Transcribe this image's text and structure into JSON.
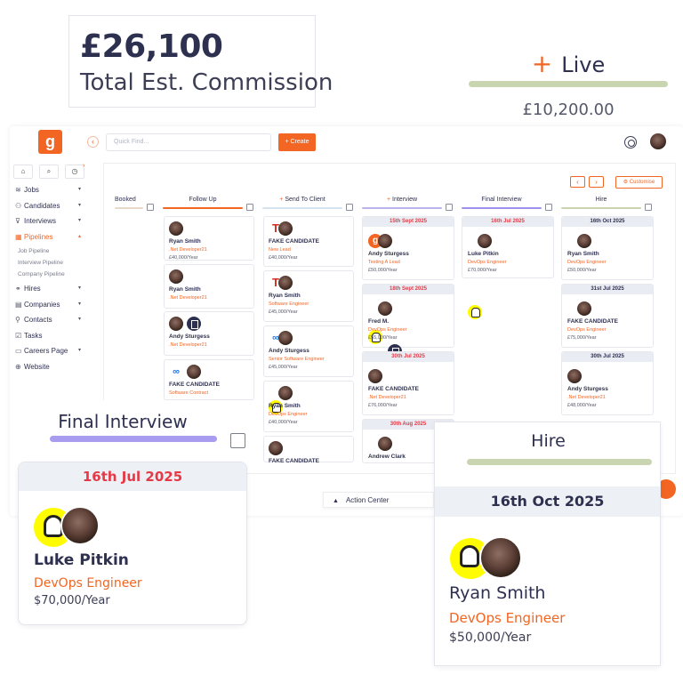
{
  "commission": {
    "value": "£26,100",
    "label": "Total Est. Commission"
  },
  "live": {
    "plus": "+",
    "label": "Live",
    "amount": "£10,200.00",
    "bar_color": "#c9d5b0"
  },
  "header": {
    "logo": "g",
    "collapse": "‹",
    "search_placeholder": "Quick Find...",
    "create_label": "+ Create"
  },
  "sidebar": {
    "quick_icons": [
      "home-icon",
      "search-icon",
      "clock-icon"
    ],
    "items": [
      {
        "label": "Jobs",
        "icon": "layers-icon",
        "chevron": "▾"
      },
      {
        "label": "Candidates",
        "icon": "users-icon",
        "chevron": "▾"
      },
      {
        "label": "Interviews",
        "icon": "filter-icon",
        "chevron": "▾"
      },
      {
        "label": "Pipelines",
        "icon": "grid-icon",
        "chevron": "▴",
        "active": true
      },
      {
        "label": "Hires",
        "icon": "handshake-icon",
        "chevron": "▾"
      },
      {
        "label": "Companies",
        "icon": "building-icon",
        "chevron": "▾"
      },
      {
        "label": "Contacts",
        "icon": "person-icon",
        "chevron": "▾"
      },
      {
        "label": "Tasks",
        "icon": "checkbox-icon",
        "chevron": ""
      },
      {
        "label": "Careers Page",
        "icon": "briefcase-icon",
        "chevron": "▾"
      },
      {
        "label": "Website",
        "icon": "globe-icon",
        "chevron": ""
      }
    ],
    "subitems": [
      "Job Pipeline",
      "Interview Pipeline",
      "Company Pipeline"
    ]
  },
  "board": {
    "prev": "‹",
    "next": "›",
    "customise_label": "⚙ Customise",
    "columns": [
      {
        "title": "Booked",
        "plus": "",
        "color": "#e8d9c8"
      },
      {
        "title": "Follow Up",
        "plus": "",
        "color": "#f26522"
      },
      {
        "title": "Send To Client",
        "plus": "+",
        "color": "#d6e4f0"
      },
      {
        "title": "Interview",
        "plus": "+",
        "color": "#b9b4ec"
      },
      {
        "title": "Final Interview",
        "plus": "",
        "color": "#9d93ee"
      },
      {
        "title": "Hire",
        "plus": "",
        "color": "#c9d5b0"
      }
    ],
    "followup_cards": [
      {
        "name": "Ryan Smith",
        "role": ".Net Developer21",
        "salary": "£40,000/Year"
      },
      {
        "name": "Ryan Smith",
        "role": ".Net Developer21",
        "salary": ""
      },
      {
        "name": "Andy Sturgess",
        "role": ".Net Developer21",
        "salary": ""
      },
      {
        "name": "FAKE CANDIDATE",
        "role": "Software Contract",
        "salary": ""
      }
    ],
    "send_cards": [
      {
        "name": "FAKE CANDIDATE",
        "role": "New Lead",
        "salary": "£40,000/Year"
      },
      {
        "name": "Ryan Smith",
        "role": "Software Engineer",
        "salary": "£45,000/Year"
      },
      {
        "name": "Andy Sturgess",
        "role": "Senior Software Engineer",
        "salary": "£45,000/Year"
      },
      {
        "name": "Ryan Smith",
        "role": "DevOps Engineer",
        "salary": "£40,000/Year"
      },
      {
        "name": "FAKE CANDIDATE",
        "role": "",
        "salary": ""
      }
    ],
    "interview_cards": [
      {
        "date": "15th Sept 2025",
        "name": "Andy Sturgess",
        "role": "Testing A Lead",
        "salary": "£50,000/Year"
      },
      {
        "date": "18th Sept 2025",
        "name": "Fred M.",
        "role": "DevOps Engineer",
        "salary": "£55,000/Year"
      },
      {
        "date": "30th Jul 2025",
        "name": "FAKE CANDIDATE",
        "role": ".Net Developer21",
        "salary": "£76,000/Year"
      },
      {
        "date": "30th Aug 2025",
        "name": "Andrew Clark",
        "role": "",
        "salary": ""
      }
    ],
    "final_cards": [
      {
        "date": "16th Jul 2025",
        "name": "Luke Pitkin",
        "role": "DevOps Engineer",
        "salary": "£70,000/Year"
      }
    ],
    "hire_cards": [
      {
        "date": "16th Oct 2025",
        "name": "Ryan Smith",
        "role": "DevOps Engineer",
        "salary": "£50,000/Year"
      },
      {
        "date": "31st Jul 2025",
        "name": "FAKE CANDIDATE",
        "role": "DevOps Engineer",
        "salary": "£75,000/Year"
      },
      {
        "date": "30th Jul 2025",
        "name": "Andy Sturgess",
        "role": ".Net Developer21",
        "salary": "£48,000/Year"
      }
    ]
  },
  "action_center": {
    "chevron": "▲",
    "label": "Action Center"
  },
  "final_interview_zoom": {
    "title": "Final Interview",
    "date": "16th Jul 2025",
    "name": "Luke Pitkin",
    "role": "DevOps Engineer",
    "salary": "$70,000/Year"
  },
  "hire_zoom": {
    "title": "Hire",
    "date": "16th Oct 2025",
    "name": "Ryan Smith",
    "role": "DevOps Engineer",
    "salary": "$50,000/Year"
  },
  "colors": {
    "accent": "#f26522",
    "navy": "#2e3050",
    "date_red": "#e63946"
  }
}
